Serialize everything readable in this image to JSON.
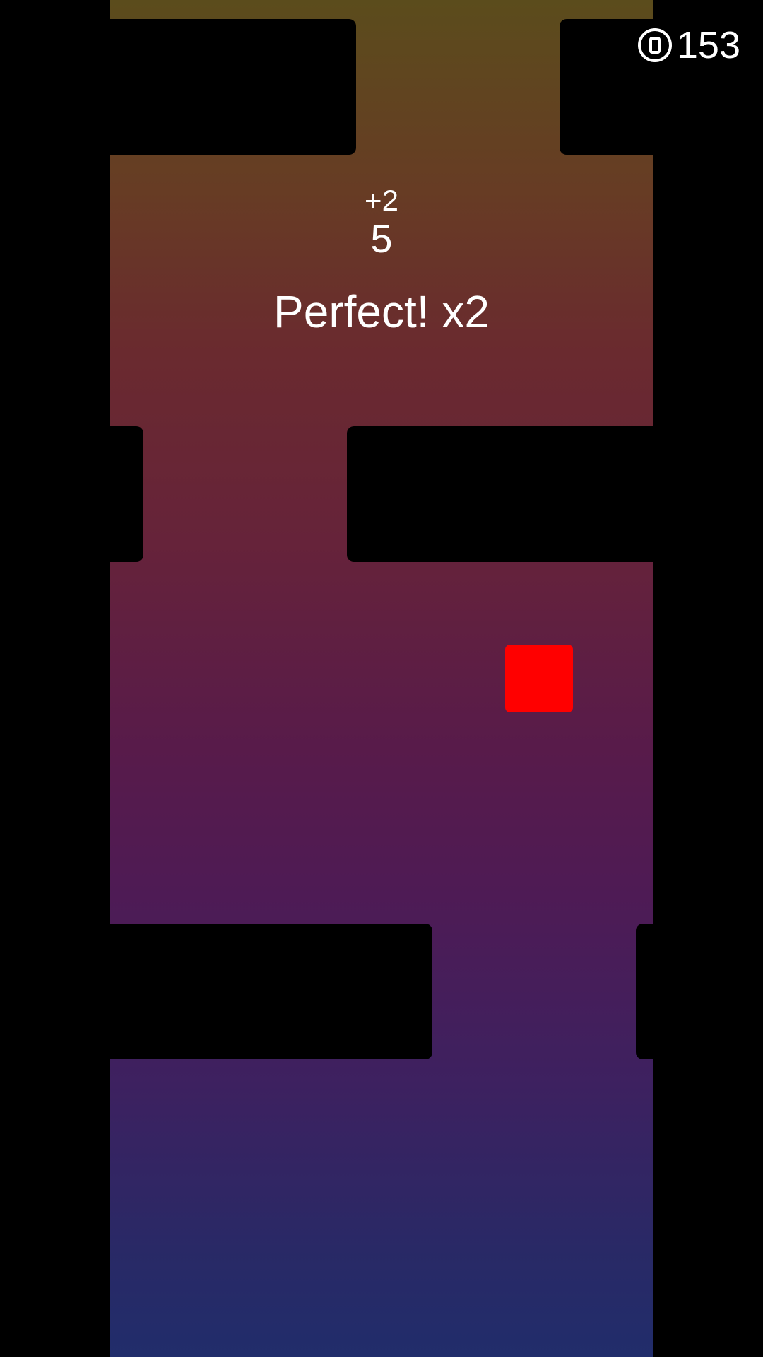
{
  "hud": {
    "coins": "153",
    "coin_icon": "coin-icon",
    "combo_bonus": "+2",
    "score": "5",
    "feedback": "Perfect! x2"
  },
  "colors": {
    "player": "#ff0000",
    "obstacle": "#000000",
    "background_top": "#5b4c1c",
    "background_bottom": "#212d6b",
    "text": "#ffffff"
  }
}
